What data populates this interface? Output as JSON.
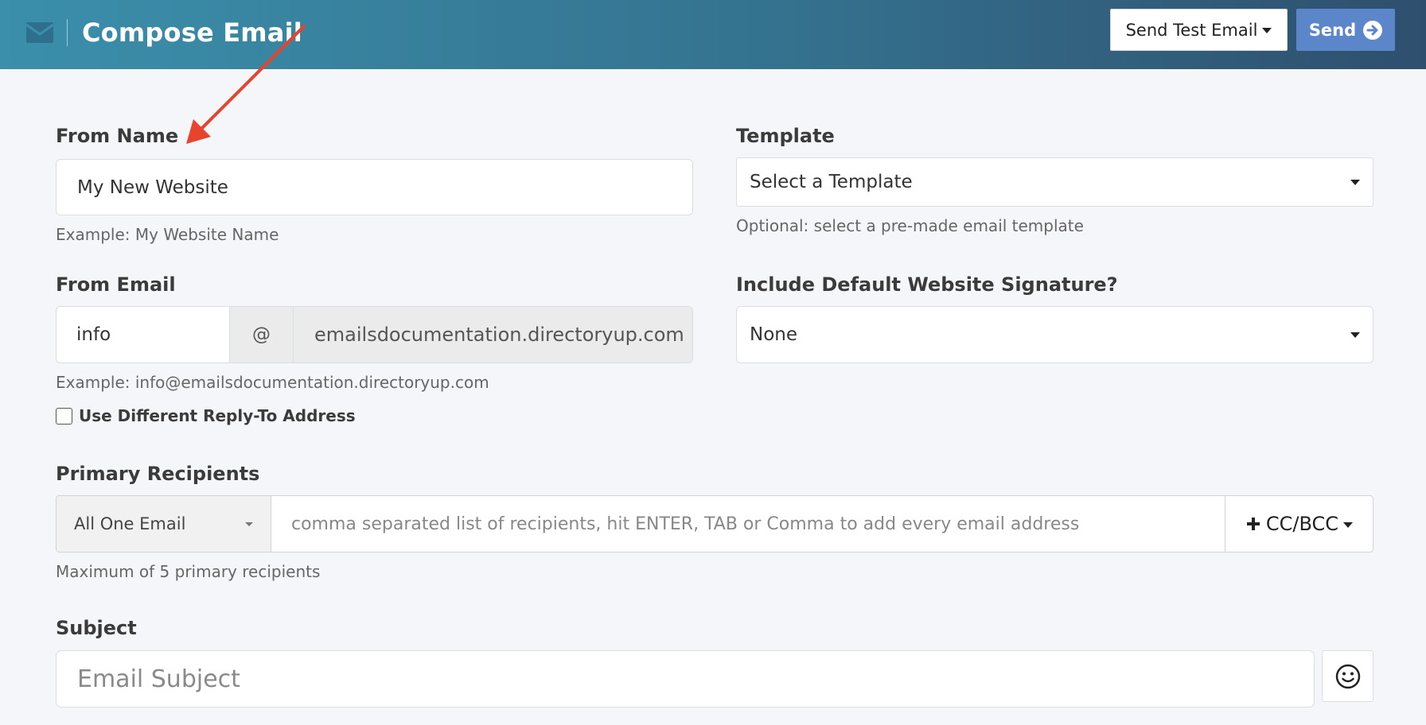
{
  "header": {
    "title": "Compose Email",
    "icon": "envelope-icon",
    "send_test_label": "Send Test Email",
    "send_label": "Send"
  },
  "from_name": {
    "label": "From Name",
    "value": "My New Website",
    "help": "Example: My Website Name"
  },
  "template": {
    "label": "Template",
    "selected": "Select a Template",
    "help": "Optional: select a pre-made email template"
  },
  "from_email": {
    "label": "From Email",
    "local_part": "info",
    "at_symbol": "@",
    "domain": "emailsdocumentation.directoryup.com",
    "help": "Example: info@emailsdocumentation.directoryup.com"
  },
  "signature": {
    "label": "Include Default Website Signature?",
    "selected": "None"
  },
  "reply_to": {
    "label": "Use Different Reply-To Address",
    "checked": false
  },
  "recipients": {
    "label": "Primary Recipients",
    "mode": "All One Email",
    "placeholder": "comma separated list of recipients, hit ENTER, TAB or Comma to add every email address",
    "ccbcc_label": "CC/BCC",
    "help": "Maximum of 5 primary recipients"
  },
  "subject": {
    "label": "Subject",
    "placeholder": "Email Subject"
  },
  "colors": {
    "header_start": "#3b8fab",
    "header_end": "#2f4f6e",
    "send_button": "#5b86c9",
    "annotation_arrow": "#e8432d"
  }
}
